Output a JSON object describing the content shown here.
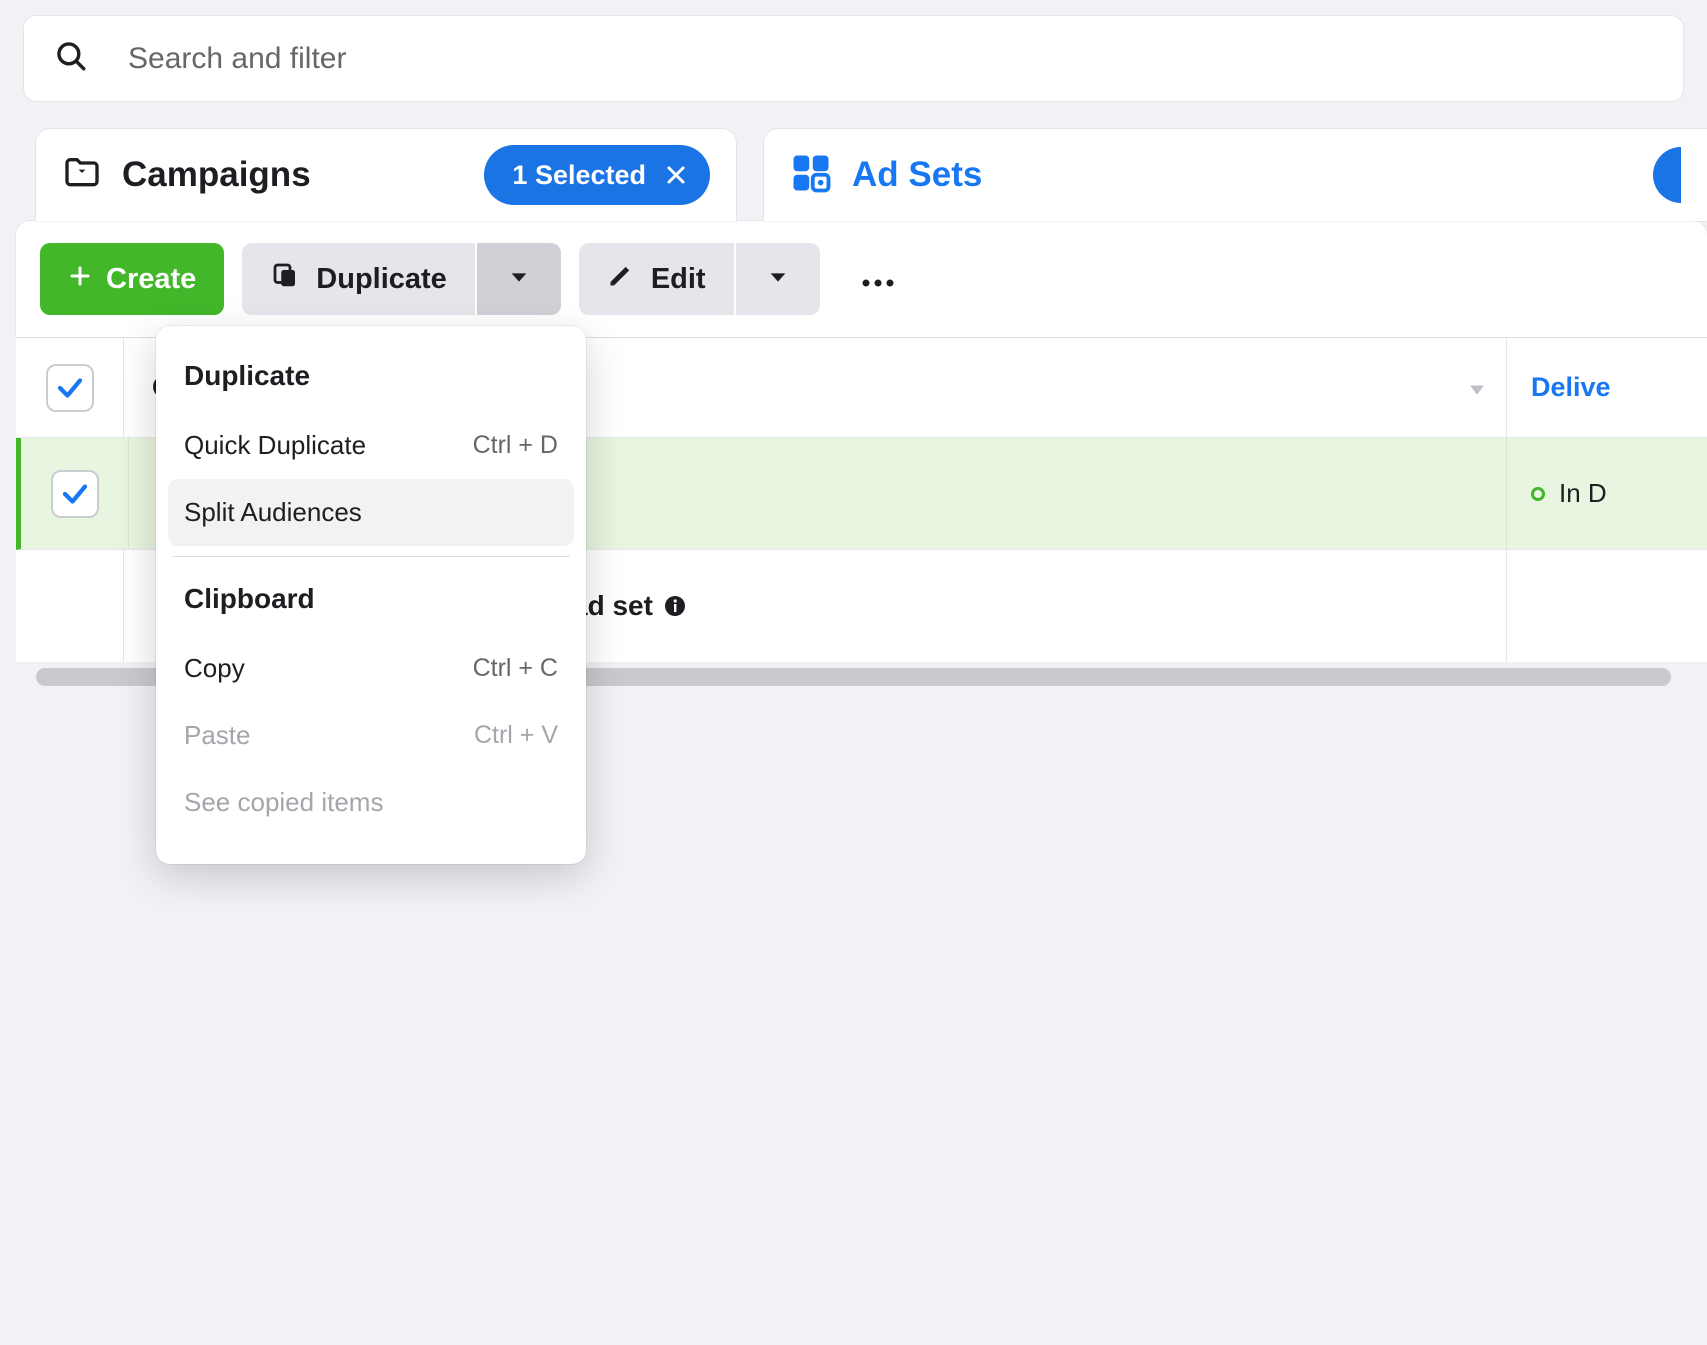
{
  "search": {
    "placeholder": "Search and filter"
  },
  "tabs": {
    "campaigns_label": "Campaigns",
    "selected_chip": "1 Selected",
    "adsets_label": "Ad Sets"
  },
  "toolbar": {
    "create_label": "Create",
    "duplicate_label": "Duplicate",
    "edit_label": "Edit"
  },
  "table": {
    "col_name_partial": "C",
    "col_delivery_label": "Delive",
    "row_status": "In D",
    "summary_label": "ad set"
  },
  "dropdown": {
    "section_duplicate": "Duplicate",
    "quick_duplicate_label": "Quick Duplicate",
    "quick_duplicate_shortcut": "Ctrl + D",
    "split_audiences_label": "Split Audiences",
    "section_clipboard": "Clipboard",
    "copy_label": "Copy",
    "copy_shortcut": "Ctrl + C",
    "paste_label": "Paste",
    "paste_shortcut": "Ctrl + V",
    "see_copied_label": "See copied items"
  }
}
